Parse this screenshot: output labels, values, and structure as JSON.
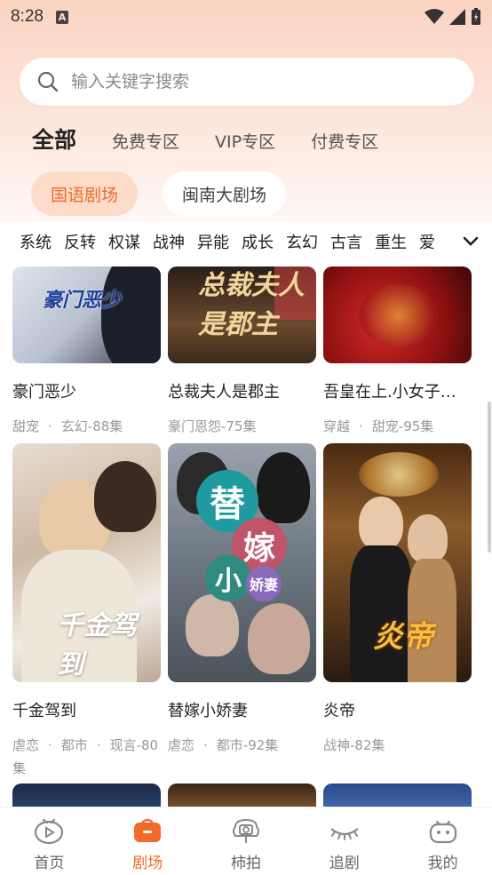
{
  "status_bar": {
    "time": "8:28",
    "notification_icon": "a-icon"
  },
  "search": {
    "placeholder": "输入关键字搜索"
  },
  "category_tabs": [
    {
      "label": "全部",
      "active": true
    },
    {
      "label": "免费专区",
      "active": false
    },
    {
      "label": "VIP专区",
      "active": false
    },
    {
      "label": "付费专区",
      "active": false
    }
  ],
  "chips": [
    {
      "label": "国语剧场",
      "active": true
    },
    {
      "label": "闽南大剧场",
      "active": false
    }
  ],
  "tags": [
    "系统",
    "反转",
    "权谋",
    "战神",
    "异能",
    "成长",
    "玄幻",
    "古言",
    "重生",
    "爱"
  ],
  "cards": [
    {
      "title": "豪门恶少",
      "meta": [
        "甜宠",
        "玄幻-88集"
      ],
      "poster_text": "豪门恶少"
    },
    {
      "title": "总裁夫人是郡主",
      "meta": [
        "豪门恩怨-75集"
      ],
      "poster_text": "总裁夫人是郡主"
    },
    {
      "title": "吾皇在上.小女子…",
      "meta": [
        "穿越",
        "甜宠-95集"
      ],
      "poster_text": ""
    },
    {
      "title": "千金驾到",
      "meta": [
        "虐恋",
        "都市",
        "现言-80集"
      ],
      "poster_text": "千金驾到"
    },
    {
      "title": "替嫁小娇妻",
      "meta": [
        "虐恋",
        "都市-92集"
      ],
      "poster_text": "替嫁小娇妻"
    },
    {
      "title": "炎帝",
      "meta": [
        "战神-82集"
      ],
      "poster_text": "炎帝"
    }
  ],
  "bottom_nav": [
    {
      "label": "首页",
      "icon": "tv-icon",
      "active": false
    },
    {
      "label": "剧场",
      "icon": "briefcase-icon",
      "active": true
    },
    {
      "label": "柿拍",
      "icon": "camera-icon",
      "active": false
    },
    {
      "label": "追剧",
      "icon": "eye-closed-icon",
      "active": false
    },
    {
      "label": "我的",
      "icon": "robot-icon",
      "active": false
    }
  ],
  "colors": {
    "accent": "#f06a2a",
    "chip_active_bg": "#fcdcc8",
    "header_bg": "#fbd3c1"
  }
}
